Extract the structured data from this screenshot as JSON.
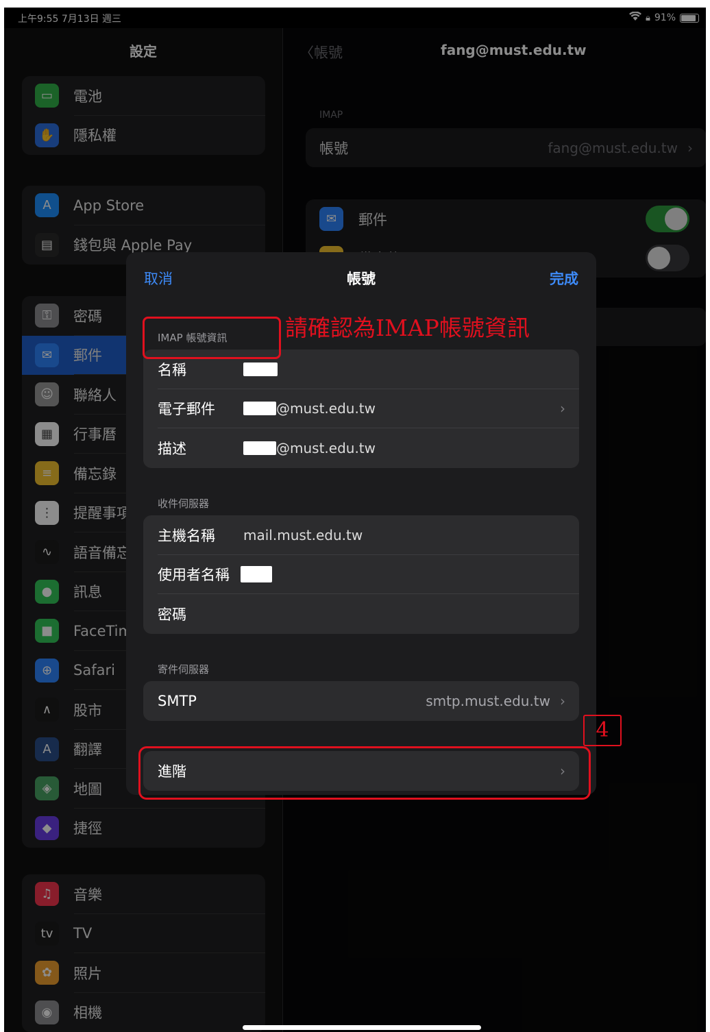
{
  "status_bar": {
    "time_date": "上午9:55  7月13日 週三",
    "battery": "91%"
  },
  "settings": {
    "title": "設定",
    "groups": [
      [
        {
          "label": "電池",
          "icon": "battery-icon",
          "color": "#32b24a",
          "glyph": "▭"
        },
        {
          "label": "隱私權",
          "icon": "hand-icon",
          "color": "#2c6fe0",
          "glyph": "✋"
        }
      ],
      [
        {
          "label": "App Store",
          "icon": "app-store-icon",
          "color": "#1e90ff",
          "glyph": "A"
        },
        {
          "label": "錢包與 Apple Pay",
          "icon": "wallet-icon",
          "color": "#2b2b2b",
          "glyph": "▤"
        }
      ],
      [
        {
          "label": "密碼",
          "icon": "key-icon",
          "color": "#8e8e93",
          "glyph": "⚿"
        },
        {
          "label": "郵件",
          "icon": "mail-icon",
          "color": "#2f86ff",
          "glyph": "✉",
          "selected": true
        },
        {
          "label": "聯絡人",
          "icon": "contacts-icon",
          "color": "#9a9a9a",
          "glyph": "☺"
        },
        {
          "label": "行事曆",
          "icon": "calendar-icon",
          "color": "#ffffff",
          "glyph": "▦"
        },
        {
          "label": "備忘錄",
          "icon": "notes-icon",
          "color": "#f5c330",
          "glyph": "≡"
        },
        {
          "label": "提醒事項",
          "icon": "reminders-icon",
          "color": "#ffffff",
          "glyph": "⋮"
        },
        {
          "label": "語音備忘錄",
          "icon": "voice-memo-icon",
          "color": "#1c1c1c",
          "glyph": "∿"
        },
        {
          "label": "訊息",
          "icon": "messages-icon",
          "color": "#34c759",
          "glyph": "●"
        },
        {
          "label": "FaceTime",
          "icon": "facetime-icon",
          "color": "#34c759",
          "glyph": "■"
        },
        {
          "label": "Safari",
          "icon": "safari-icon",
          "color": "#2f86ff",
          "glyph": "⊕"
        },
        {
          "label": "股市",
          "icon": "stocks-icon",
          "color": "#1c1c1c",
          "glyph": "∧"
        },
        {
          "label": "翻譯",
          "icon": "translate-icon",
          "color": "#2b4f8a",
          "glyph": "A"
        },
        {
          "label": "地圖",
          "icon": "maps-icon",
          "color": "#4aa564",
          "glyph": "◈"
        },
        {
          "label": "捷徑",
          "icon": "shortcuts-icon",
          "color": "#6a3de8",
          "glyph": "◆"
        }
      ],
      [
        {
          "label": "音樂",
          "icon": "music-icon",
          "color": "#f8354f",
          "glyph": "♫"
        },
        {
          "label": "TV",
          "icon": "tv-icon",
          "color": "#1c1c1c",
          "glyph": "tv"
        },
        {
          "label": "照片",
          "icon": "photos-icon",
          "color": "#f0a030",
          "glyph": "✿"
        },
        {
          "label": "相機",
          "icon": "camera-icon",
          "color": "#8e8e93",
          "glyph": "◉"
        }
      ]
    ]
  },
  "account_detail": {
    "back_label": "帳號",
    "title": "fang@must.edu.tw",
    "section": "IMAP",
    "account_label": "帳號",
    "account_value": "fang@must.edu.tw",
    "mail_label": "郵件",
    "notes_label": "備忘錄"
  },
  "sheet": {
    "cancel": "取消",
    "title": "帳號",
    "done": "完成",
    "imap_section": "IMAP 帳號資訊",
    "name_label": "名稱",
    "email_label": "電子郵件",
    "email_value": "@must.edu.tw",
    "desc_label": "描述",
    "desc_value": "@must.edu.tw",
    "incoming_section": "收件伺服器",
    "host_label": "主機名稱",
    "host_value": "mail.must.edu.tw",
    "user_label": "使用者名稱",
    "password_label": "密碼",
    "outgoing_section": "寄件伺服器",
    "smtp_label": "SMTP",
    "smtp_value": "smtp.must.edu.tw",
    "advanced_label": "進階"
  },
  "annotations": {
    "note": "請確認為IMAP帳號資訊",
    "step": "4",
    "color": "#e0101e"
  }
}
